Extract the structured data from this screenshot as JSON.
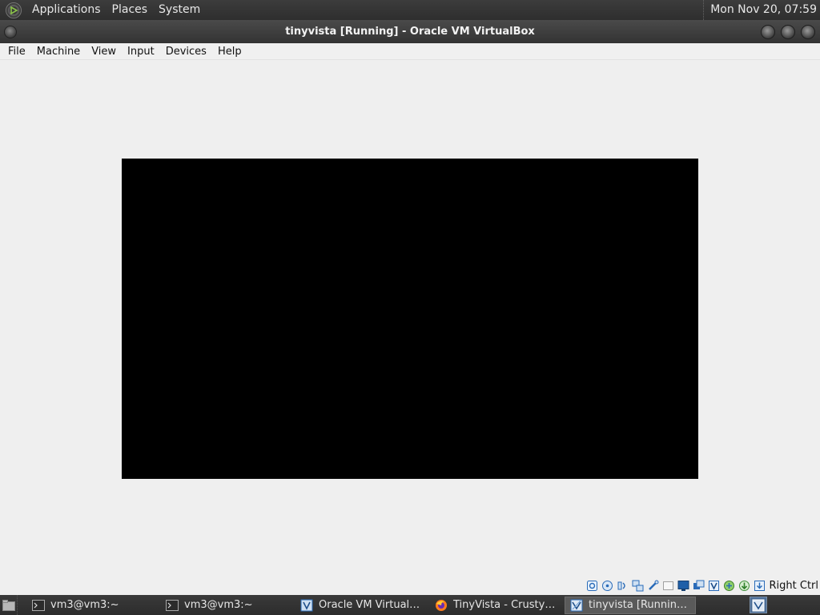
{
  "top_panel": {
    "menus": [
      "Applications",
      "Places",
      "System"
    ],
    "clock": "Mon Nov 20, 07:59",
    "logo_icon": "mate-logo-icon"
  },
  "window": {
    "title": "tinyvista [Running] - Oracle VM VirtualBox"
  },
  "menubar": {
    "items": [
      "File",
      "Machine",
      "View",
      "Input",
      "Devices",
      "Help"
    ]
  },
  "vm": {
    "screen_color": "#000000"
  },
  "statusbar": {
    "icons": [
      "hard-disk-icon",
      "optical-drive-icon",
      "audio-icon",
      "network-icon",
      "usb-icon",
      "shared-folders-icon",
      "display-icon",
      "recording-icon",
      "virtualization-icon",
      "cpu-icon",
      "mouse-integration-icon",
      "download-icon"
    ],
    "host_key": "Right Ctrl"
  },
  "taskbar": {
    "tasks": [
      {
        "label": "vm3@vm3:~",
        "icon": "terminal-icon",
        "active": false
      },
      {
        "label": "vm3@vm3:~",
        "icon": "terminal-icon",
        "active": false
      },
      {
        "label": "Oracle VM VirtualBo…",
        "icon": "virtualbox-icon",
        "active": false
      },
      {
        "label": "TinyVista - Crusty W…",
        "icon": "firefox-icon",
        "active": false
      },
      {
        "label": "tinyvista [Running] -…",
        "icon": "virtualbox-vm-icon",
        "active": true
      }
    ]
  }
}
